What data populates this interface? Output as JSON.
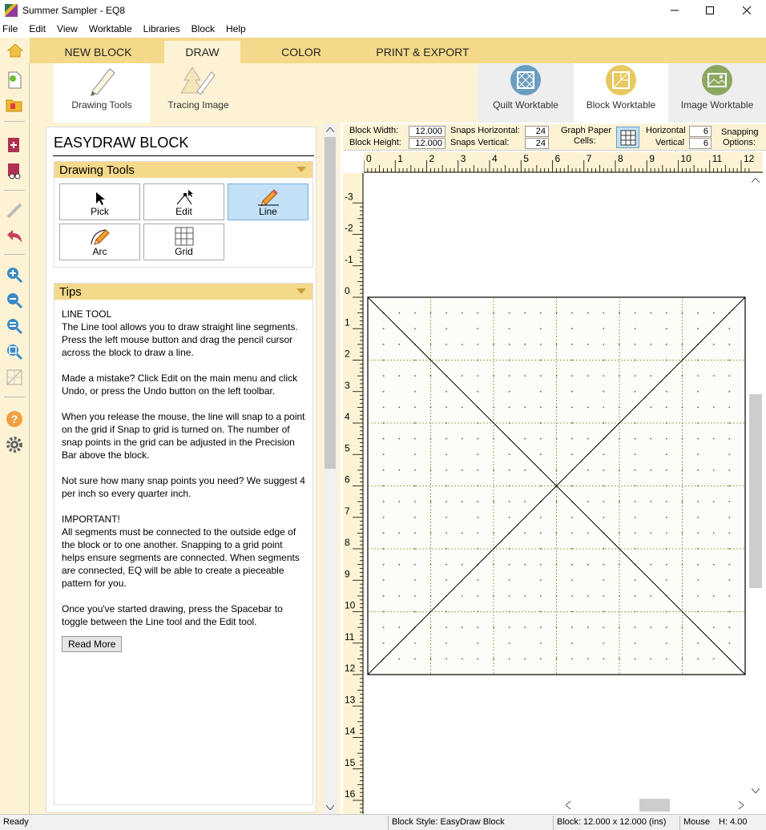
{
  "window": {
    "title": "Summer Sampler - EQ8"
  },
  "menu": [
    "File",
    "Edit",
    "View",
    "Worktable",
    "Libraries",
    "Block",
    "Help"
  ],
  "tabs": [
    {
      "label": "NEW BLOCK",
      "selected": false
    },
    {
      "label": "DRAW",
      "selected": true
    },
    {
      "label": "COLOR",
      "selected": false
    },
    {
      "label": "PRINT & EXPORT",
      "selected": false
    }
  ],
  "ribbon": {
    "drawing_tools": "Drawing Tools",
    "tracing_image": "Tracing Image",
    "quilt_worktable": "Quilt Worktable",
    "block_worktable": "Block Worktable",
    "image_worktable": "Image Worktable"
  },
  "panel": {
    "title": "EASYDRAW BLOCK",
    "drawing_tools_header": "Drawing Tools",
    "tools": [
      {
        "label": "Pick",
        "icon": "arrow-pointer-icon",
        "selected": false
      },
      {
        "label": "Edit",
        "icon": "edit-node-icon",
        "selected": false
      },
      {
        "label": "Line",
        "icon": "pencil-line-icon",
        "selected": true
      },
      {
        "label": "Arc",
        "icon": "pencil-arc-icon",
        "selected": false
      },
      {
        "label": "Grid",
        "icon": "grid-icon",
        "selected": false
      }
    ],
    "tips_header": "Tips",
    "tips": [
      "LINE TOOL\nThe Line tool allows you to draw straight line segments. Press the left mouse button and drag the pencil cursor across the block to draw a line.",
      "Made a mistake? Click Edit on the main menu and click Undo, or press the Undo button on the left toolbar.",
      "When you release the mouse, the line will snap to a point on the grid if Snap to grid is turned on. The number of snap points in the grid can be adjusted in the Precision Bar above the block.",
      "Not sure how many snap points you need? We suggest 4 per inch so every quarter inch.",
      "IMPORTANT!\nAll segments must be connected to the outside edge of the block or to one another. Snapping to a grid point helps ensure segments are connected. When segments are connected, EQ will be able to create a pieceable pattern for you.",
      "Once you've started drawing, press the Spacebar to toggle between the Line tool and the Edit tool."
    ],
    "read_more": "Read More"
  },
  "precision": {
    "block_width_label": "Block Width:",
    "block_width": "12.000",
    "block_height_label": "Block Height:",
    "block_height": "12.000",
    "snaps_h_label": "Snaps Horizontal:",
    "snaps_h": "24",
    "snaps_v_label": "Snaps Vertical:",
    "snaps_v": "24",
    "graph_paper_label1": "Graph Paper",
    "graph_paper_label2": "Cells:",
    "horizontal_label": "Horizontal",
    "horizontal": "6",
    "vertical_label": "Vertical",
    "vertical": "6",
    "snapping_label1": "Snapping",
    "snapping_label2": "Options:"
  },
  "rulers": {
    "h_labels": [
      "0",
      "1",
      "2",
      "3",
      "4",
      "5",
      "6",
      "7",
      "8",
      "9",
      "10",
      "11",
      "12"
    ],
    "v_labels": [
      "-3",
      "-2",
      "-1",
      "0",
      "1",
      "2",
      "3",
      "4",
      "5",
      "6",
      "7",
      "8",
      "9",
      "10",
      "11",
      "12",
      "13",
      "14",
      "15",
      "16"
    ]
  },
  "status": {
    "ready": "Ready",
    "block_style": "Block Style: EasyDraw Block",
    "block_size": "Block: 12.000 x 12.000 (ins)",
    "mouse": "Mouse",
    "h": "H:  4.00"
  },
  "colors": {
    "ribbon": "#fdf3d4",
    "tab": "#f5d98a",
    "selected_tool": "#c2e1f7"
  }
}
